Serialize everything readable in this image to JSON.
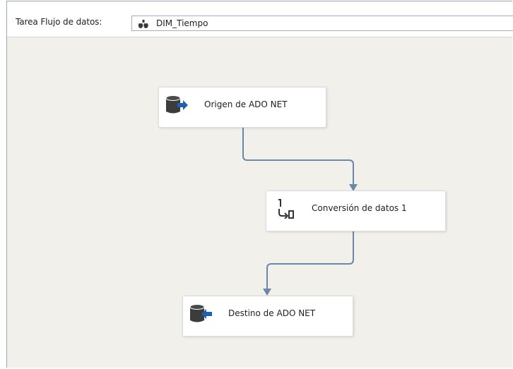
{
  "toolbar": {
    "label": "Tarea Flujo de datos:",
    "selected_task": "DIM_Tiempo",
    "task_icon": "data-flow-task-icon"
  },
  "components": [
    {
      "label": "Origen de ADO NET",
      "icon": "ado-net-source-icon"
    },
    {
      "label": "Conversión de datos 1",
      "icon": "data-conversion-icon"
    },
    {
      "label": "Destino de ADO NET",
      "icon": "ado-net-destination-icon"
    }
  ],
  "colors": {
    "connector": "#6b87aa",
    "arrow_icon": "#1f5fb0",
    "cylinder_icon": "#3c3c3c"
  }
}
